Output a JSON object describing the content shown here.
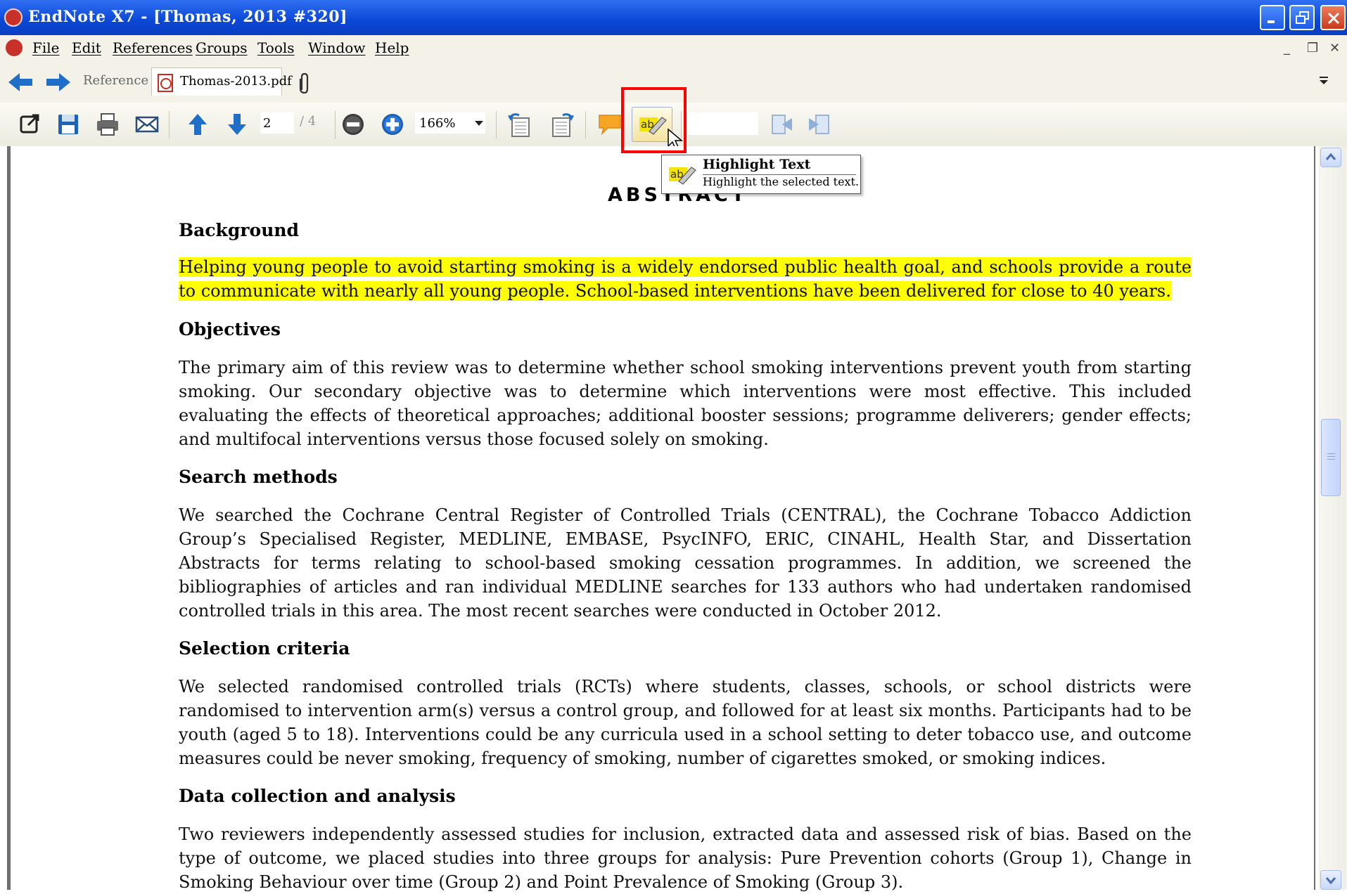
{
  "window": {
    "title": "EndNote X7 - [Thomas, 2013 #320]"
  },
  "menubar": {
    "items": [
      "File",
      "Edit",
      "References",
      "Groups",
      "Tools",
      "Window",
      "Help"
    ]
  },
  "tabs": {
    "reference_label": "Reference",
    "pdf_label": "Thomas-2013.pdf"
  },
  "toolbar": {
    "page_current": "2",
    "page_total": "/ 4",
    "zoom": "166%",
    "highlight_color": "#ffff00",
    "callout_color": "#ff0000"
  },
  "tooltip": {
    "title": "Highlight Text",
    "description": "Highlight the selected text."
  },
  "document": {
    "heading": "ABSTRACT",
    "sections": [
      {
        "heading": "Background",
        "paragraph": "Helping young people to avoid starting smoking is a widely endorsed public health goal, and schools provide a route to communicate with nearly all young people. School-based interventions have been delivered for close to 40 years.",
        "highlighted": true
      },
      {
        "heading": "Objectives",
        "paragraph": "The primary aim of this review was to determine whether school smoking interventions prevent youth from starting smoking. Our secondary objective was to determine which interventions were most effective. This included evaluating the effects of theoretical approaches; additional booster sessions; programme deliverers; gender effects; and multifocal interventions versus those focused solely on smoking."
      },
      {
        "heading": "Search methods",
        "paragraph": "We searched the Cochrane Central Register of Controlled Trials (CENTRAL), the Cochrane Tobacco Addiction Group’s Specialised Register, MEDLINE, EMBASE, PsycINFO, ERIC, CINAHL, Health Star, and Dissertation Abstracts for terms relating to school-based smoking cessation programmes. In addition, we screened the bibliographies of articles and ran individual MEDLINE searches for 133 authors who had undertaken randomised controlled trials in this area. The most recent searches were conducted in October 2012."
      },
      {
        "heading": "Selection criteria",
        "paragraph": "We selected randomised controlled trials (RCTs) where students, classes, schools, or school districts were randomised to intervention arm(s) versus a control group, and followed for at least six months. Participants had to be youth (aged 5 to 18). Interventions could be any curricula used in a school setting to deter tobacco use, and outcome measures could be never smoking, frequency of smoking, number of cigarettes smoked, or smoking indices."
      },
      {
        "heading": "Data collection and analysis",
        "paragraph": "Two reviewers independently assessed studies for inclusion, extracted data and assessed risk of bias. Based on the type of outcome, we placed studies into three groups for analysis: Pure Prevention cohorts (Group 1), Change in Smoking Behaviour over time (Group 2) and Point Prevalence of Smoking (Group 3)."
      }
    ]
  }
}
